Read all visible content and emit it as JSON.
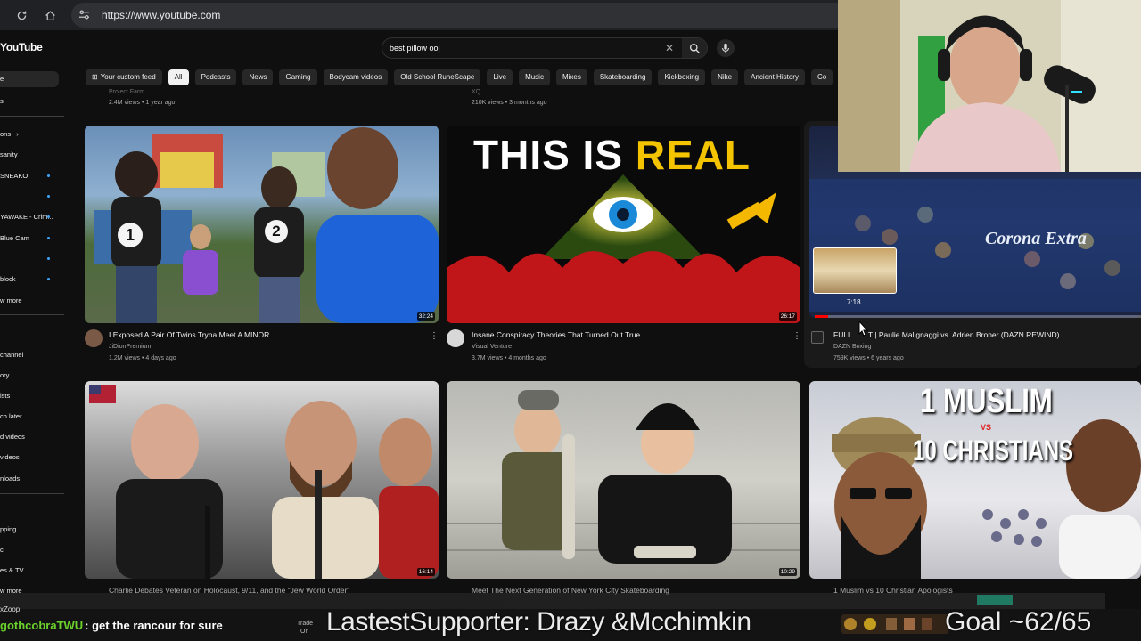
{
  "browser": {
    "url": "https://www.youtube.com"
  },
  "youtube": {
    "logo": "YouTube",
    "search_value": "best pillow oo|",
    "chips": [
      "Your custom feed",
      "All",
      "Podcasts",
      "News",
      "Gaming",
      "Bodycam videos",
      "Old School RuneScape",
      "Live",
      "Music",
      "Mixes",
      "Skateboarding",
      "Kickboxing",
      "Nike",
      "Ancient History",
      "Co"
    ],
    "active_chip": "All"
  },
  "sidebar": {
    "items": [
      "e",
      "s",
      "ons",
      "sanity",
      "SNEAKO",
      "",
      "YAWAKE - Crim...",
      "Blue Cam",
      "",
      "block",
      "w more",
      "channel",
      "ory",
      "ists",
      "ch later",
      "d videos",
      "videos",
      "nloads",
      "pping",
      "c",
      "es & TV",
      "w more"
    ]
  },
  "videos_top_partial": [
    {
      "meta": "2.4M views • 1 year ago",
      "channel": "Project Farm"
    },
    {
      "meta": "210K views • 3 months ago",
      "channel": "XQ"
    }
  ],
  "videos": [
    {
      "title": "I Exposed A Pair Of Twins Tryna Meet A MINOR",
      "channel": "JiDionPremium",
      "meta": "1.2M views • 4 days ago",
      "duration": "32:24",
      "thumb_labels": [
        "1",
        "2"
      ]
    },
    {
      "title": "Insane Conspiracy Theories That Turned Out True",
      "channel": "Visual Venture",
      "meta": "3.7M views • 4 months ago",
      "duration": "26:17",
      "thumb_text_1": "THIS IS ",
      "thumb_text_2": "REAL"
    },
    {
      "title": "FULL FIGHT | Paulie Malignaggi vs. Adrien Broner (DAZN REWIND)",
      "title_visible": "FULL ",
      "title_rest": "T | Paulie Malignaggi vs. Adrien Broner (DAZN REWIND)",
      "channel": "DAZN Boxing",
      "meta": "759K views • 6 years ago",
      "preview_time": "7:18",
      "thumb_brand": "Corona Extra"
    },
    {
      "title": "Charlie Debates Veteran on Holocaust, 9/11, and the \"Jew World Order\"",
      "duration": "16:14"
    },
    {
      "title": "Meet The Next Generation of New York City Skateboarding",
      "duration": "10:29"
    },
    {
      "title": "1 Muslim vs 10 Christian Apologists",
      "thumb_text_1": "1 MUSLIM",
      "thumb_vs": "VS",
      "thumb_text_2": "10 CHRISTIANS"
    }
  ],
  "overlay": {
    "chat_user": "gothcobraTWU",
    "chat_message": ": get the rancour for sure",
    "supporter": "LastestSupporter: Drazy &Mcchimkin",
    "goal": "Goal ~62/65",
    "small_label_1": "xZoop:",
    "small_label_2": "Trade",
    "small_label_3": "On"
  }
}
